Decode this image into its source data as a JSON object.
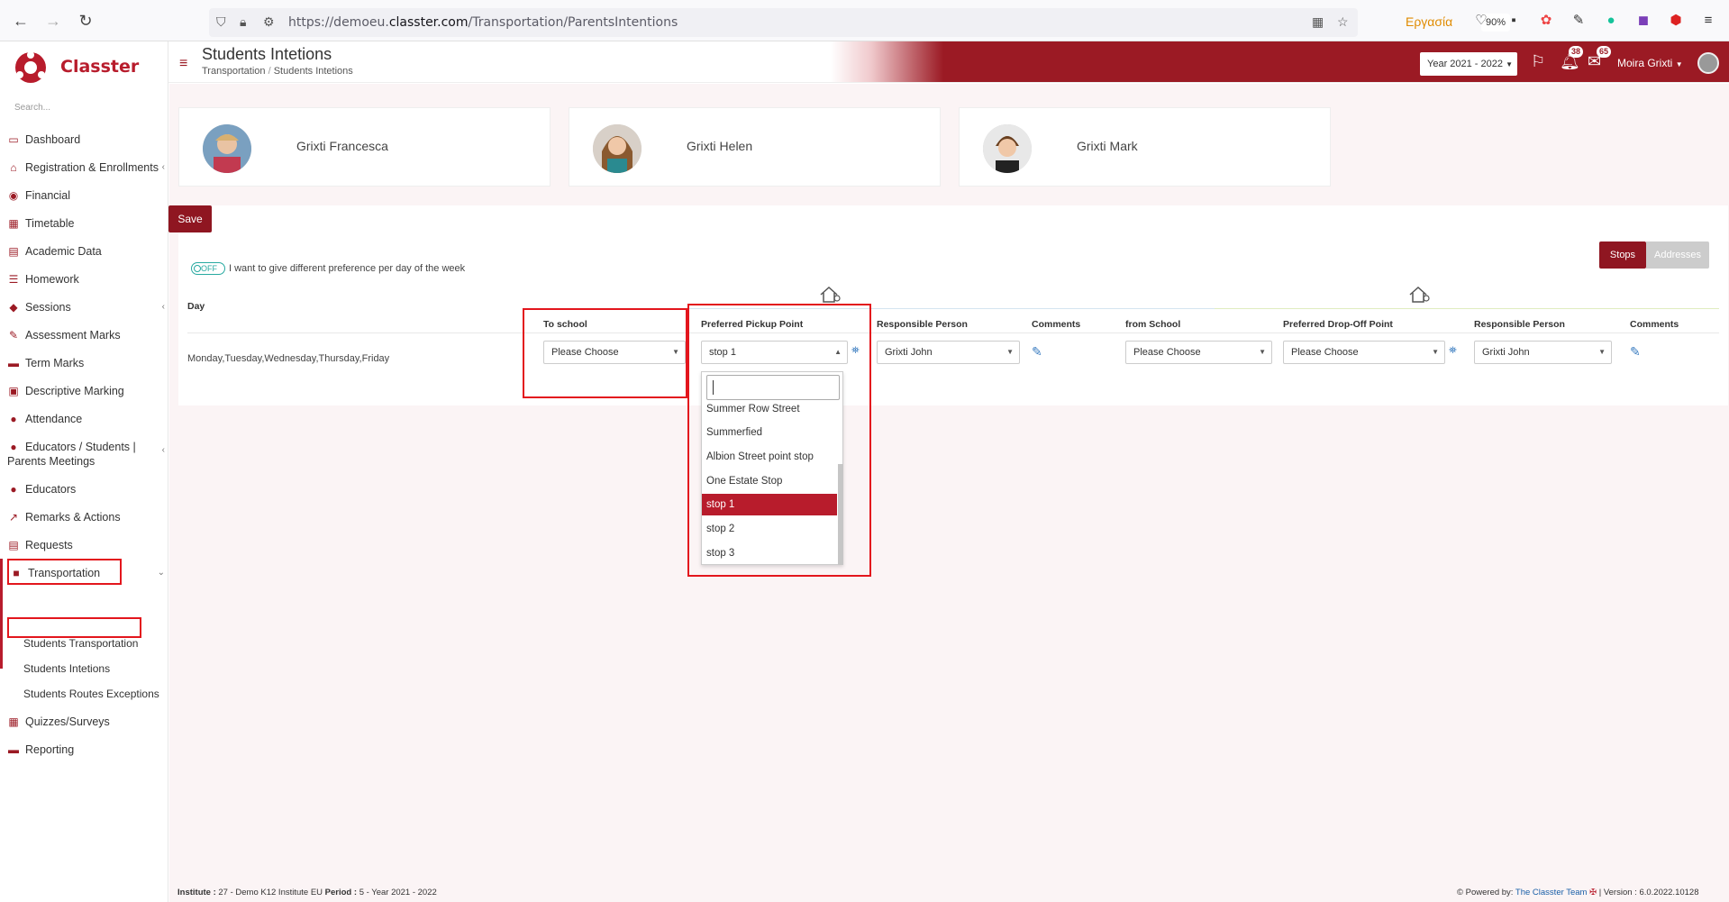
{
  "browser": {
    "url_prefix": "https://demoeu.",
    "url_domain": "classter.com",
    "url_path": "/Transportation/ParentsIntentions",
    "container": "Εργασία",
    "zoom": "90%"
  },
  "sidebar": {
    "logo_text": "Classter",
    "search_placeholder": "Search...",
    "items": [
      {
        "label": "Dashboard",
        "icon": "monitor-icon"
      },
      {
        "label": "Registration & Enrollments",
        "icon": "institution-icon"
      },
      {
        "label": "Financial",
        "icon": "coins-icon"
      },
      {
        "label": "Timetable",
        "icon": "calendar-icon"
      },
      {
        "label": "Academic Data",
        "icon": "academic-icon"
      },
      {
        "label": "Homework",
        "icon": "list-icon"
      },
      {
        "label": "Sessions",
        "icon": "sessions-icon"
      },
      {
        "label": "Assessment Marks",
        "icon": "edit-icon"
      },
      {
        "label": "Term Marks",
        "icon": "book-icon"
      },
      {
        "label": "Descriptive Marking",
        "icon": "descriptive-icon"
      },
      {
        "label": "Attendance",
        "icon": "user-icon"
      },
      {
        "label": "Educators / Students |",
        "label2": "Parents Meetings",
        "icon": "meeting-icon"
      },
      {
        "label": "Educators",
        "icon": "educator-icon"
      },
      {
        "label": "Remarks & Actions",
        "icon": "chart-icon"
      },
      {
        "label": "Requests",
        "icon": "request-icon"
      },
      {
        "label": "Transportation",
        "icon": "bus-icon"
      },
      {
        "label": "Quizzes/Surveys",
        "icon": "quiz-icon"
      },
      {
        "label": "Reporting",
        "icon": "print-icon"
      }
    ],
    "sub_items": [
      "Students Transportation",
      "Students Intetions",
      "Students Routes Exceptions"
    ]
  },
  "header": {
    "title": "Students Intetions",
    "breadcrumb_1": "Transportation",
    "breadcrumb_sep": "/",
    "breadcrumb_2": "Students Intetions",
    "year": "Year 2021 - 2022",
    "notifications": "38",
    "messages": "65",
    "user": "Moira Grixti"
  },
  "students": [
    "Grixti Francesca",
    "Grixti Helen",
    "Grixti Mark"
  ],
  "save_label": "Save",
  "toggle": {
    "state": "OFF",
    "label": "I want to give different preference per day of the week"
  },
  "view_buttons": {
    "stops": "Stops",
    "addresses": "Addresses"
  },
  "table": {
    "headers": [
      "Day",
      "To school",
      "Preferred Pickup Point",
      "Responsible Person",
      "Comments",
      "from School",
      "Preferred Drop-Off Point",
      "Responsible Person",
      "Comments"
    ],
    "row": {
      "day": "Monday,Tuesday,Wednesday,Thursday,Friday",
      "to_school": "Please Choose",
      "pickup": "stop 1",
      "responsible_to": "Grixti John",
      "from_school": "Please Choose",
      "dropoff": "Please Choose",
      "responsible_from": "Grixti John"
    }
  },
  "dropdown": {
    "options": [
      "Summer Row Street",
      "Summerfied",
      "Albion Street point stop",
      "One Estate Stop",
      "stop 1",
      "stop 2",
      "stop 3"
    ],
    "selected": "stop 1"
  },
  "footer": {
    "institute_label": "Institute :",
    "institute": "27 - Demo K12 Institute EU",
    "period_label": "Period :",
    "period": "5 - Year 2021 - 2022",
    "powered": "Powered by:",
    "team": "The Classter Team",
    "version": "| Version : 6.0.2022.10128"
  },
  "colors": {
    "brand": "#9b1a24",
    "highlight": "#e3161d",
    "toggle": "#27a9a0"
  }
}
